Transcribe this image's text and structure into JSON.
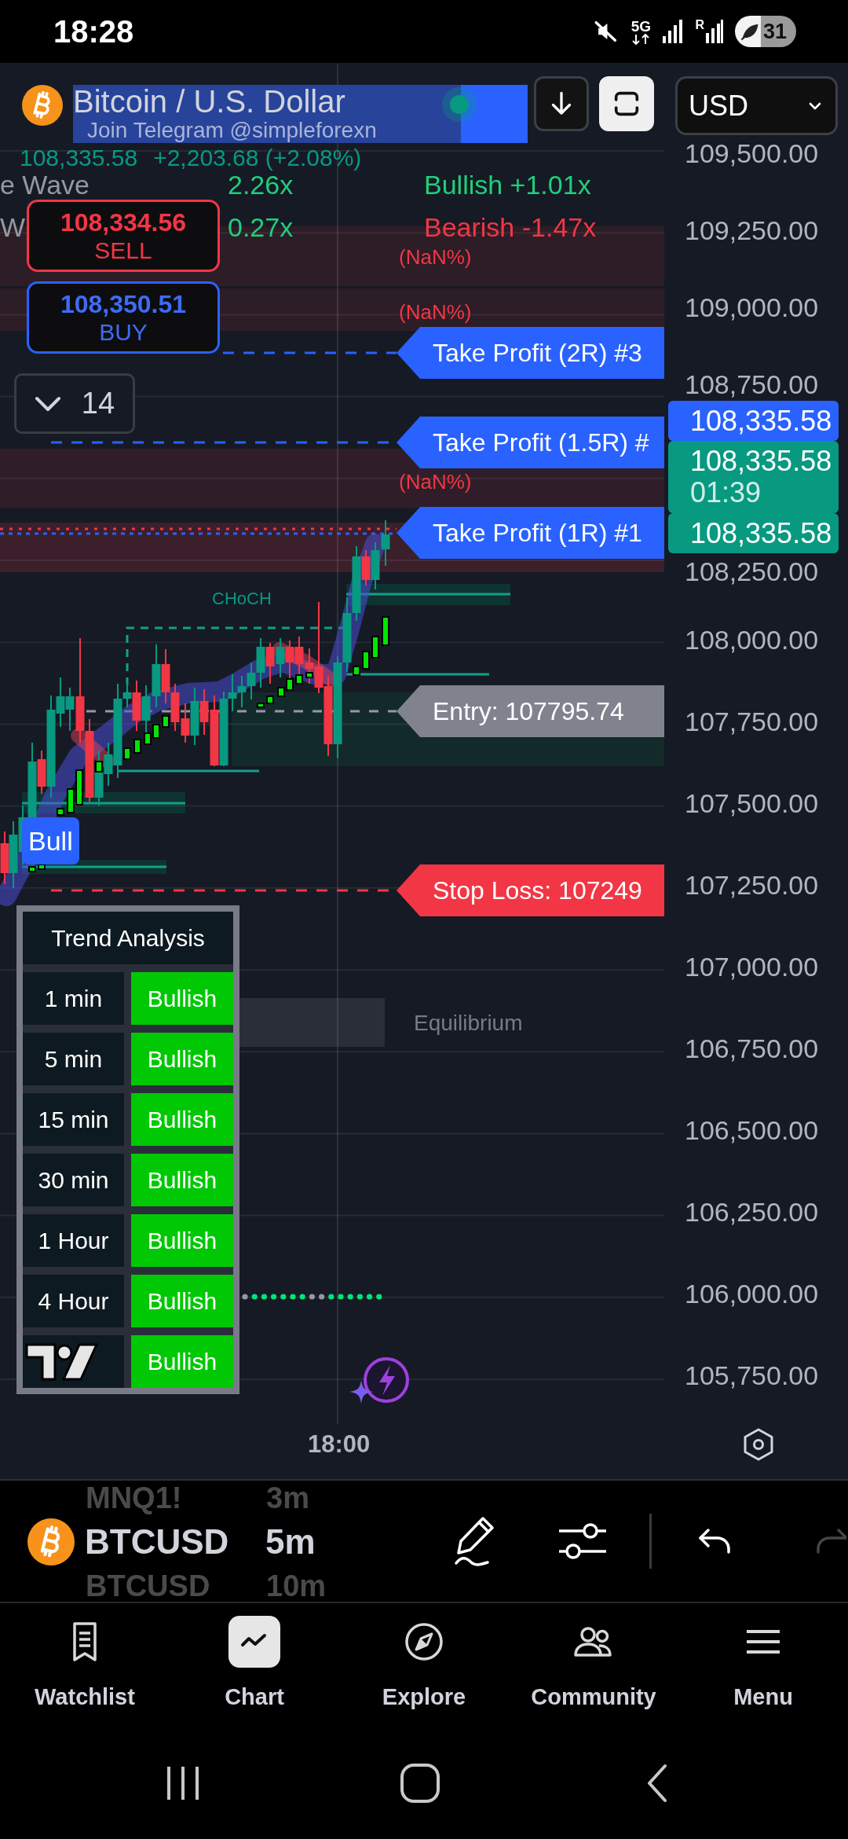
{
  "status_bar": {
    "time": "18:28",
    "network": "5G",
    "roaming": "R",
    "battery": "31"
  },
  "chart_header": {
    "title": "Bitcoin / U.S. Dollar",
    "banner_text": "Join Telegram @simpleforexn",
    "live": true,
    "currency": "USD",
    "last_price": "108,335.58",
    "change": "+2,203.68 (+2.08%)"
  },
  "indicator_table": [
    {
      "label": "e Wave",
      "ratio": "2.26x",
      "bias": "Bullish +1.01x",
      "kind": "bull"
    },
    {
      "label": "W",
      "ratio": "0.27x",
      "bias": "Bearish -1.47x",
      "kind": "bear"
    }
  ],
  "order_buttons": [
    {
      "price": "108,334.56",
      "label": "SELL",
      "kind": "sell"
    },
    {
      "price": "108,350.51",
      "label": "BUY",
      "kind": "buy"
    }
  ],
  "objects_toggle": {
    "count": "14",
    "expanded": false
  },
  "zone_labels": [
    "(NaN%)",
    "(NaN%)",
    "(NaN%)"
  ],
  "level_flags": [
    {
      "text": "Take Profit (2R) #3",
      "kind": "target"
    },
    {
      "text": "Take Profit (1.5R) #",
      "kind": "target"
    },
    {
      "text": "Take Profit (1R) #1",
      "kind": "target"
    },
    {
      "text": "Entry: 107795.74",
      "kind": "entry"
    },
    {
      "text": "Stop Loss: 107249",
      "kind": "stop"
    }
  ],
  "structure_labels": {
    "choch": "CHoCH",
    "bull": "Bull",
    "equilibrium": "Equilibrium"
  },
  "price_axis": {
    "above": [
      "109,500.00",
      "109,250.00",
      "109,000.00",
      "108,750.00"
    ],
    "tags": [
      {
        "price": "108,335.58",
        "color": "#2962ff"
      },
      {
        "price": "108,335.58",
        "countdown": "01:39",
        "color": "#089981"
      },
      {
        "price": "108,335.58",
        "color": "#089981"
      }
    ],
    "below": [
      "108,250.00",
      "108,000.00",
      "107,750.00",
      "107,500.00",
      "107,250.00",
      "107,000.00",
      "106,750.00",
      "106,500.00",
      "106,250.00",
      "106,000.00",
      "105,750.00"
    ]
  },
  "trend_table": {
    "title": "Trend Analysis",
    "rows": [
      {
        "timeframe": "1 min",
        "trend": "Bullish",
        "kind": "bull"
      },
      {
        "timeframe": "5 min",
        "trend": "Bullish",
        "kind": "bull"
      },
      {
        "timeframe": "15 min",
        "trend": "Bullish",
        "kind": "bull"
      },
      {
        "timeframe": "30 min",
        "trend": "Bullish",
        "kind": "bull"
      },
      {
        "timeframe": "1 Hour",
        "trend": "Bullish",
        "kind": "bull"
      },
      {
        "timeframe": "4 Hour",
        "trend": "Bullish",
        "kind": "bull"
      },
      {
        "trend": "Bullish",
        "kind": "bull"
      }
    ]
  },
  "time_axis": [
    "18:00"
  ],
  "toolbar": {
    "symbols": [
      {
        "symbol": "MNQ1!",
        "interval": "3m",
        "selected": false
      },
      {
        "symbol": "BTCUSD",
        "interval": "5m",
        "selected": true
      },
      {
        "symbol": "BTCUSD",
        "interval": "10m",
        "selected": false
      }
    ]
  },
  "bottom_nav": [
    {
      "label": "Watchlist",
      "selected": false
    },
    {
      "label": "Chart",
      "selected": true
    },
    {
      "label": "Explore",
      "selected": false
    },
    {
      "label": "Community",
      "selected": false
    },
    {
      "label": "Menu",
      "selected": false
    }
  ]
}
